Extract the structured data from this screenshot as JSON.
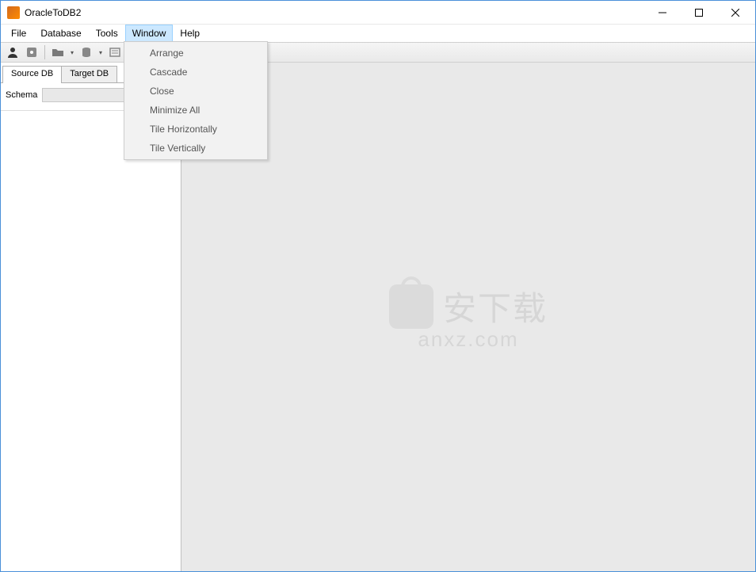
{
  "titlebar": {
    "title": "OracleToDB2"
  },
  "menubar": {
    "items": [
      "File",
      "Database",
      "Tools",
      "Window",
      "Help"
    ],
    "active_index": 3
  },
  "dropdown": {
    "items": [
      "Arrange",
      "Cascade",
      "Close",
      "Minimize All",
      "Tile Horizontally",
      "Tile Vertically"
    ]
  },
  "tabs": {
    "items": [
      "Source DB",
      "Target DB"
    ],
    "active_index": 0
  },
  "schema": {
    "label": "Schema",
    "value": ""
  },
  "watermark": {
    "cn": "安下载",
    "en": "anxz.com"
  }
}
